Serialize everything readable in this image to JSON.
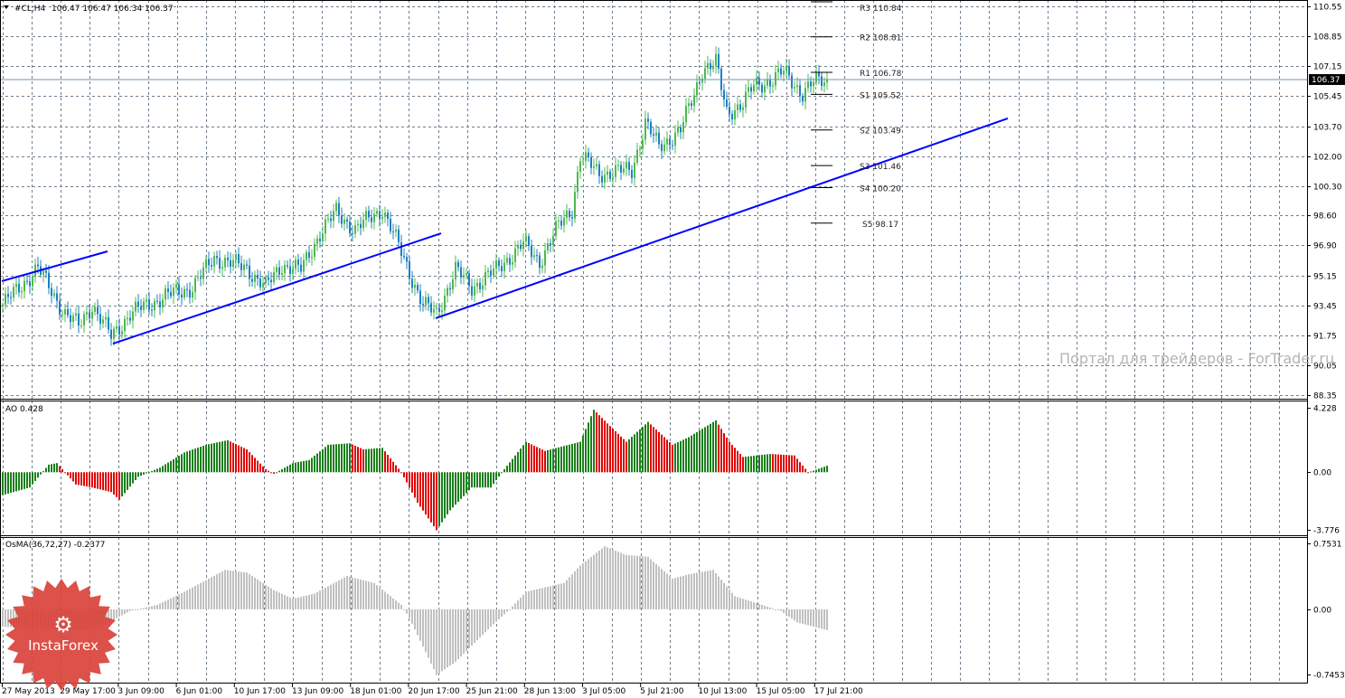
{
  "header": {
    "symbol": "#CL,H4",
    "ohlc": "106.47 106.47 106.34 106.37"
  },
  "watermark": "Портал для трейдеров - ForTrader.ru",
  "logo_text": "InstaForex",
  "colors": {
    "bull": "#4fb84f",
    "bear": "#1e7fc2",
    "trend": "#0000ff",
    "ao_up": "#1a7f1a",
    "ao_down": "#e00000",
    "osma": "#c0c0c0",
    "grid": "#6f7f8f"
  },
  "chart_data": [
    {
      "type": "candlestick",
      "title": "#CL,H4",
      "current_price": 106.37,
      "price_label": "106.37",
      "ylim": [
        88.35,
        110.55
      ],
      "y_ticks": [
        "110.55",
        "108.85",
        "107.15",
        "105.45",
        "103.70",
        "102.00",
        "100.30",
        "98.60",
        "96.90",
        "95.15",
        "93.45",
        "91.75",
        "90.05",
        "88.35"
      ],
      "x_ticks": [
        "27 May 2013",
        "29 May 17:00",
        "3 Jun 09:00",
        "6 Jun 01:00",
        "10 Jun 17:00",
        "13 Jun 09:00",
        "18 Jun 01:00",
        "20 Jun 17:00",
        "25 Jun 21:00",
        "28 Jun 13:00",
        "3 Jul 05:00",
        "5 Jul 21:00",
        "10 Jul 13:00",
        "15 Jul 05:00",
        "17 Jul 21:00"
      ],
      "close_keypoints_bar_price": [
        [
          0,
          93.5
        ],
        [
          13,
          95.6
        ],
        [
          23,
          93.0
        ],
        [
          28,
          92.3
        ],
        [
          33,
          93.5
        ],
        [
          40,
          91.7
        ],
        [
          47,
          93.0
        ],
        [
          60,
          94.0
        ],
        [
          70,
          94.5
        ],
        [
          78,
          96.2
        ],
        [
          90,
          95.6
        ],
        [
          97,
          94.5
        ],
        [
          103,
          95.8
        ],
        [
          110,
          95.5
        ],
        [
          117,
          97.6
        ],
        [
          123,
          98.8
        ],
        [
          130,
          97.8
        ],
        [
          140,
          99.0
        ],
        [
          147,
          96.5
        ],
        [
          155,
          93.5
        ],
        [
          160,
          93.0
        ],
        [
          167,
          95.5
        ],
        [
          173,
          94.5
        ],
        [
          182,
          95.5
        ],
        [
          192,
          97.0
        ],
        [
          198,
          96.0
        ],
        [
          205,
          98.0
        ],
        [
          210,
          99.0
        ],
        [
          213,
          102.0
        ],
        [
          220,
          101.0
        ],
        [
          232,
          101.2
        ],
        [
          237,
          103.9
        ],
        [
          242,
          102.5
        ],
        [
          250,
          103.5
        ],
        [
          255,
          105.5
        ],
        [
          258,
          107.0
        ],
        [
          263,
          107.3
        ],
        [
          267,
          104.5
        ],
        [
          273,
          105.0
        ],
        [
          277,
          106.0
        ],
        [
          283,
          106.3
        ],
        [
          288,
          106.8
        ],
        [
          295,
          105.6
        ],
        [
          299,
          106.2
        ],
        [
          304,
          106.37
        ]
      ],
      "pivots": [
        {
          "label": "R3 110.84",
          "price": 110.84
        },
        {
          "label": "R2 108.81",
          "price": 108.81
        },
        {
          "label": "R1 106.78",
          "price": 106.78
        },
        {
          "label": "S1 105.52",
          "price": 105.52
        },
        {
          "label": "S2 103.49",
          "price": 103.49
        },
        {
          "label": "S3 101.46",
          "price": 101.46
        },
        {
          "label": "S4 100.20",
          "price": 100.2
        },
        {
          "label": "S5 98.17",
          "price": 98.17
        }
      ],
      "trendlines_bar_price": [
        [
          [
            0,
            94.86
          ],
          [
            39,
            96.56
          ]
        ],
        [
          [
            41,
            91.29
          ],
          [
            162,
            97.59
          ]
        ],
        [
          [
            160,
            92.74
          ],
          [
            371,
            104.15
          ]
        ]
      ]
    },
    {
      "type": "bar",
      "title": "AO 0.428",
      "ylim": [
        -3.776,
        4.228
      ],
      "y_ticks": [
        "4.228",
        "0.00",
        "-3.776"
      ],
      "keypoints_bar_value": [
        [
          0,
          -1.5
        ],
        [
          10,
          -1.0
        ],
        [
          17,
          0.5
        ],
        [
          20,
          0.6
        ],
        [
          27,
          -0.8
        ],
        [
          33,
          -1.0
        ],
        [
          40,
          -1.3
        ],
        [
          43,
          -1.8
        ],
        [
          50,
          -0.3
        ],
        [
          58,
          0.3
        ],
        [
          67,
          1.3
        ],
        [
          75,
          1.8
        ],
        [
          83,
          2.1
        ],
        [
          90,
          1.5
        ],
        [
          97,
          0.2
        ],
        [
          100,
          -0.1
        ],
        [
          107,
          0.6
        ],
        [
          113,
          0.8
        ],
        [
          120,
          1.8
        ],
        [
          128,
          1.9
        ],
        [
          133,
          1.5
        ],
        [
          140,
          1.6
        ],
        [
          147,
          0.0
        ],
        [
          153,
          -2.0
        ],
        [
          160,
          -3.8
        ],
        [
          165,
          -2.5
        ],
        [
          173,
          -1.0
        ],
        [
          180,
          -1.0
        ],
        [
          185,
          0.2
        ],
        [
          193,
          2.0
        ],
        [
          200,
          1.4
        ],
        [
          213,
          2.0
        ],
        [
          218,
          4.1
        ],
        [
          223,
          3.2
        ],
        [
          230,
          2.0
        ],
        [
          238,
          3.3
        ],
        [
          247,
          1.8
        ],
        [
          253,
          2.3
        ],
        [
          263,
          3.4
        ],
        [
          268,
          2.0
        ],
        [
          273,
          1.0
        ],
        [
          283,
          1.2
        ],
        [
          292,
          1.1
        ],
        [
          297,
          0.0
        ],
        [
          299,
          0.1
        ],
        [
          304,
          0.428
        ]
      ]
    },
    {
      "type": "bar",
      "title": "OsMA(36,72,27) -0.2377",
      "ylim": [
        -0.7453,
        0.7531
      ],
      "y_ticks": [
        "0.7531",
        "0.00",
        "-0.7453"
      ],
      "keypoints_bar_value": [
        [
          0,
          -0.2
        ],
        [
          33,
          -0.25
        ],
        [
          47,
          -0.02
        ],
        [
          57,
          0.05
        ],
        [
          67,
          0.2
        ],
        [
          82,
          0.45
        ],
        [
          90,
          0.42
        ],
        [
          100,
          0.22
        ],
        [
          107,
          0.12
        ],
        [
          115,
          0.18
        ],
        [
          127,
          0.38
        ],
        [
          137,
          0.3
        ],
        [
          147,
          0.05
        ],
        [
          150,
          -0.1
        ],
        [
          160,
          -0.75
        ],
        [
          167,
          -0.6
        ],
        [
          180,
          -0.2
        ],
        [
          187,
          0.0
        ],
        [
          193,
          0.2
        ],
        [
          207,
          0.3
        ],
        [
          213,
          0.5
        ],
        [
          222,
          0.72
        ],
        [
          230,
          0.62
        ],
        [
          238,
          0.6
        ],
        [
          247,
          0.35
        ],
        [
          253,
          0.4
        ],
        [
          262,
          0.45
        ],
        [
          270,
          0.15
        ],
        [
          280,
          0.05
        ],
        [
          287,
          -0.02
        ],
        [
          293,
          -0.15
        ],
        [
          304,
          -0.2377
        ]
      ]
    }
  ]
}
